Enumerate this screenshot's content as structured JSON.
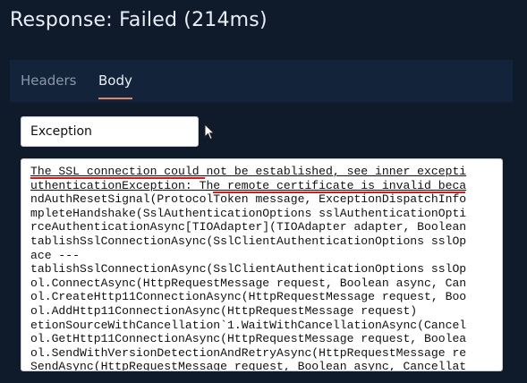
{
  "header": {
    "title": "Response: Failed (214ms)"
  },
  "tabs": [
    {
      "label": "Headers",
      "active": false
    },
    {
      "label": "Body",
      "active": true
    }
  ],
  "select": {
    "value": "Exception"
  },
  "output": {
    "lines": [
      "The SSL connection could not be established, see inner excepti",
      "uthenticationException: The remote certificate is invalid beca",
      "ndAuthResetSignal(ProtocolToken message, ExceptionDispatchInfo",
      "mpleteHandshake(SslAuthenticationOptions sslAuthenticationOpti",
      "rceAuthenticationAsync[TIOAdapter](TIOAdapter adapter, Boolean",
      "tablishSslConnectionAsync(SslClientAuthenticationOptions sslOp",
      "ace ---",
      "tablishSslConnectionAsync(SslClientAuthenticationOptions sslOp",
      "ol.ConnectAsync(HttpRequestMessage request, Boolean async, Can",
      "ol.CreateHttp11ConnectionAsync(HttpRequestMessage request, Boo",
      "ol.AddHttp11ConnectionAsync(HttpRequestMessage request)",
      "etionSourceWithCancellation`1.WaitWithCancellationAsync(Cancel",
      "ol.GetHttp11ConnectionAsync(HttpRequestMessage request, Boolea",
      "ol.SendWithVersionDetectionAndRetryAsync(HttpRequestMessage re",
      "SendAsync(HttpRequestMessage request, Boolean async, Cancellat"
    ]
  },
  "colors": {
    "background": "#0f1a2b",
    "tabbar": "#13243a",
    "active_tab_underline": "#d8876a",
    "error_underline": "#d11c1c"
  }
}
